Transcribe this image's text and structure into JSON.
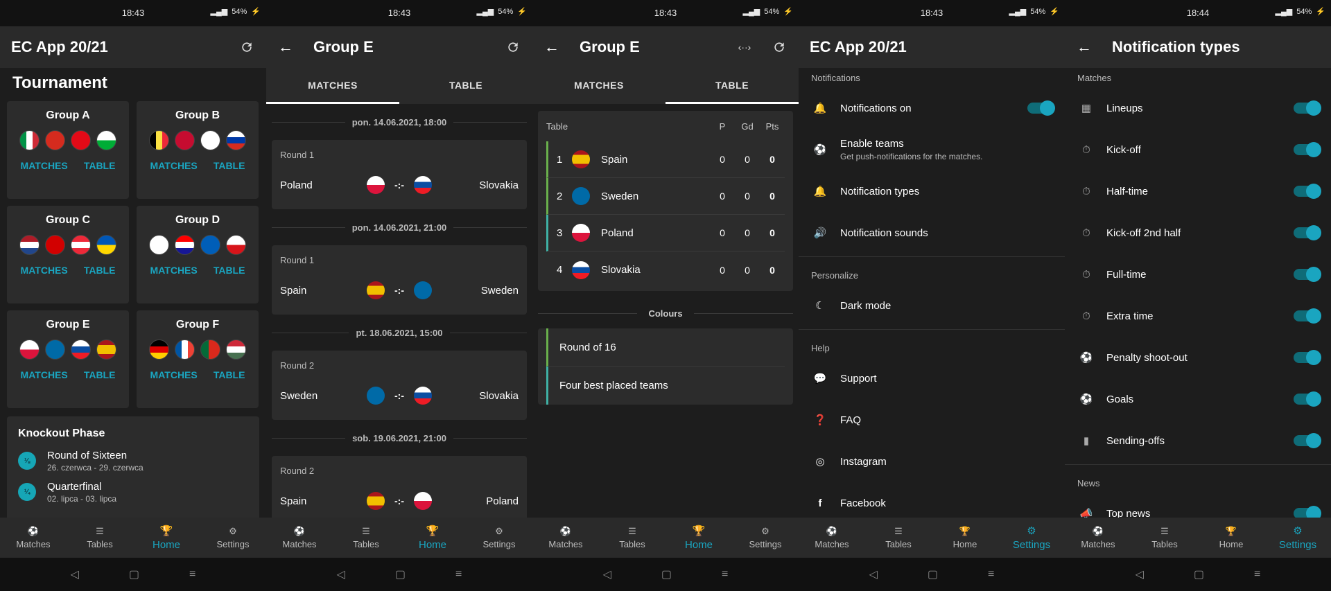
{
  "status": {
    "time_a": "18:43",
    "time_b": "18:44",
    "battery": "54%"
  },
  "nav": {
    "matches": "Matches",
    "tables": "Tables",
    "home": "Home",
    "settings": "Settings"
  },
  "screen1": {
    "app_title": "EC App 20/21",
    "section_title": "Tournament",
    "groups": [
      {
        "name": "Group A",
        "flags": [
          "italy",
          "switzerland",
          "turkey",
          "wales"
        ]
      },
      {
        "name": "Group B",
        "flags": [
          "belgium",
          "denmark",
          "finland",
          "russia"
        ]
      },
      {
        "name": "Group C",
        "flags": [
          "netherlands",
          "north-macedonia",
          "austria",
          "ukraine"
        ]
      },
      {
        "name": "Group D",
        "flags": [
          "england",
          "croatia",
          "scotland",
          "czechia"
        ]
      },
      {
        "name": "Group E",
        "flags": [
          "poland",
          "sweden",
          "slovakia",
          "spain"
        ]
      },
      {
        "name": "Group F",
        "flags": [
          "germany",
          "france",
          "portugal",
          "hungary"
        ]
      }
    ],
    "link_matches": "MATCHES",
    "link_table": "TABLE",
    "knockout_title": "Knockout Phase",
    "knockout": [
      {
        "badge": "⅛",
        "title": "Round of Sixteen",
        "sub": "26. czerwca - 29. czerwca"
      },
      {
        "badge": "¼",
        "title": "Quarterfinal",
        "sub": "02. lipca - 03. lipca"
      }
    ]
  },
  "screen2": {
    "title": "Group E",
    "tab_matches": "MATCHES",
    "tab_table": "TABLE",
    "matches": [
      {
        "date": "pon. 14.06.2021, 18:00",
        "round": "Round 1",
        "home": "Poland",
        "home_flag": "poland",
        "score": "-:-",
        "away": "Slovakia",
        "away_flag": "slovakia"
      },
      {
        "date": "pon. 14.06.2021, 21:00",
        "round": "Round 1",
        "home": "Spain",
        "home_flag": "spain",
        "score": "-:-",
        "away": "Sweden",
        "away_flag": "sweden"
      },
      {
        "date": "pt. 18.06.2021, 15:00",
        "round": "Round 2",
        "home": "Sweden",
        "home_flag": "sweden",
        "score": "-:-",
        "away": "Slovakia",
        "away_flag": "slovakia"
      },
      {
        "date": "sob. 19.06.2021, 21:00",
        "round": "Round 2",
        "home": "Spain",
        "home_flag": "spain",
        "score": "-:-",
        "away": "Poland",
        "away_flag": "poland"
      }
    ]
  },
  "screen3": {
    "title": "Group E",
    "tab_matches": "MATCHES",
    "tab_table": "TABLE",
    "table_label": "Table",
    "col_p": "P",
    "col_gd": "Gd",
    "col_pts": "Pts",
    "rows": [
      {
        "pos": "1",
        "team": "Spain",
        "flag": "spain",
        "p": "0",
        "gd": "0",
        "pts": "0",
        "color": "#6ab04c"
      },
      {
        "pos": "2",
        "team": "Sweden",
        "flag": "sweden",
        "p": "0",
        "gd": "0",
        "pts": "0",
        "color": "#6ab04c"
      },
      {
        "pos": "3",
        "team": "Poland",
        "flag": "poland",
        "p": "0",
        "gd": "0",
        "pts": "0",
        "color": "#3fb1a5"
      },
      {
        "pos": "4",
        "team": "Slovakia",
        "flag": "slovakia",
        "p": "0",
        "gd": "0",
        "pts": "0",
        "color": "#2c2c2c"
      }
    ],
    "colours_title": "Colours",
    "colours": [
      {
        "label": "Round of 16",
        "color": "#6ab04c"
      },
      {
        "label": "Four best placed teams",
        "color": "#3fb1a5"
      }
    ]
  },
  "screen4": {
    "title": "EC App 20/21",
    "sec_notifications": "Notifications",
    "notifications_on": "Notifications on",
    "enable_teams": "Enable teams",
    "enable_teams_sub": "Get push-notifications for the matches.",
    "notification_types": "Notification types",
    "notification_sounds": "Notification sounds",
    "sec_personalize": "Personalize",
    "dark_mode": "Dark mode",
    "sec_help": "Help",
    "support": "Support",
    "faq": "FAQ",
    "instagram": "Instagram",
    "facebook": "Facebook"
  },
  "screen5": {
    "title": "Notification types",
    "sec_matches": "Matches",
    "items": [
      {
        "label": "Lineups",
        "icon": "lineups-icon"
      },
      {
        "label": "Kick-off",
        "icon": "stopwatch-icon"
      },
      {
        "label": "Half-time",
        "icon": "stopwatch-icon"
      },
      {
        "label": "Kick-off 2nd half",
        "icon": "stopwatch-icon"
      },
      {
        "label": "Full-time",
        "icon": "stopwatch-icon"
      },
      {
        "label": "Extra time",
        "icon": "stopwatch-plus-icon"
      },
      {
        "label": "Penalty shoot-out",
        "icon": "penalty-icon"
      },
      {
        "label": "Goals",
        "icon": "ball-icon"
      },
      {
        "label": "Sending-offs",
        "icon": "card-icon"
      }
    ],
    "sec_news": "News",
    "top_news": "Top news"
  },
  "colors": {
    "accent": "#1aa5c0",
    "background": "#1d1d1d",
    "card": "#2c2c2c",
    "appbar": "#2a2a2a"
  }
}
